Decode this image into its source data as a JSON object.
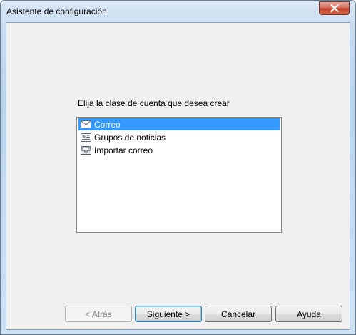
{
  "window": {
    "title": "Asistente de configuración",
    "close_icon": "close-x-icon"
  },
  "main": {
    "prompt": "Elija la clase de cuenta que desea crear",
    "account_types": [
      {
        "label": "Correo",
        "icon": "envelope-icon",
        "selected": true
      },
      {
        "label": "Grupos de noticias",
        "icon": "newsgroup-icon",
        "selected": false
      },
      {
        "label": "Importar correo",
        "icon": "inbox-tray-icon",
        "selected": false
      }
    ]
  },
  "buttons": {
    "back": "< Atrás",
    "next": "Siguiente >",
    "cancel": "Cancelar",
    "help": "Ayuda"
  },
  "colors": {
    "selection": "#3399ff",
    "close_button": "#c4402b"
  }
}
